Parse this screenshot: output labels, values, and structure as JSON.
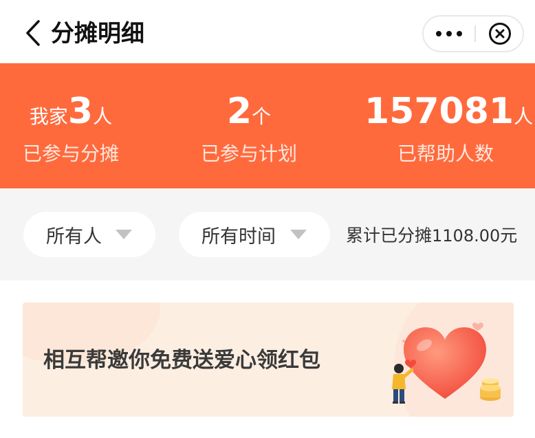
{
  "header": {
    "title": "分摊明细"
  },
  "icons": {
    "back": "chevron-left-icon",
    "more": "more-dots-icon",
    "close": "close-circle-icon"
  },
  "stats": [
    {
      "prefix": "我家",
      "value": "3",
      "unit": "人",
      "label": "已参与分摊"
    },
    {
      "prefix": "",
      "value": "2",
      "unit": "个",
      "label": "已参与计划"
    },
    {
      "prefix": "",
      "value": "157081",
      "unit": "人",
      "label": "已帮助人数"
    }
  ],
  "filters": {
    "person": "所有人",
    "time": "所有时间",
    "total_prefix": "累计已分摊",
    "total_amount": "1108.00",
    "total_unit": "元"
  },
  "banner": {
    "text": "相互帮邀你免费送爱心领红包"
  },
  "colors": {
    "accent": "#ff6a3d",
    "filter_bg": "#f5f5f5",
    "banner_bg": "#fdeee2",
    "heart": "#f7614a"
  }
}
